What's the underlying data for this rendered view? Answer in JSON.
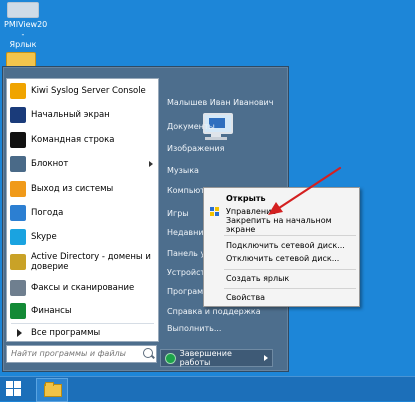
{
  "desktop": {
    "icons": [
      {
        "label_line1": "PMIView20 -",
        "label_line2": "Ярлык"
      }
    ]
  },
  "start_menu": {
    "left_items": [
      {
        "label": "Kiwi Syslog Server Console",
        "icon": "kiwi-icon",
        "color": "#f0a400"
      },
      {
        "label": "Начальный экран",
        "icon": "start-screen-icon",
        "color": "#1a3b7a"
      },
      {
        "label": "Командная строка",
        "icon": "cmd-icon",
        "color": "#111111"
      },
      {
        "label": "Блокнот",
        "icon": "notepad-icon",
        "color": "#4a6a88"
      },
      {
        "label": "Выход из системы",
        "icon": "logoff-key-icon",
        "color": "#f09a1a"
      },
      {
        "label": "Погода",
        "icon": "weather-icon",
        "color": "#2c7fd2"
      },
      {
        "label": "Skype",
        "icon": "skype-icon",
        "color": "#1aa3e0"
      },
      {
        "label_line1": "Active Directory - домены и",
        "label_line2": "доверие",
        "icon": "ad-icon",
        "color": "#c9a227"
      },
      {
        "label": "Факсы и сканирование",
        "icon": "fax-icon",
        "color": "#6f7f8f"
      },
      {
        "label": "Финансы",
        "icon": "finance-icon",
        "color": "#138a36"
      }
    ],
    "all_programs": "Все программы",
    "search_placeholder": "Найти программы и файлы",
    "right_links": [
      "Малышев Иван Иванович",
      "Документы",
      "Изображения",
      "Музыка",
      "Компьютер",
      "Игры",
      "Недавние",
      "Панель у",
      "Устройства",
      "Программы",
      "Справка и поддержка",
      "Выполнить..."
    ],
    "shutdown_label": "Завершение работы"
  },
  "context_menu": {
    "items": [
      {
        "label": "Открыть",
        "bold": true
      },
      {
        "label": "Управление",
        "bold": false,
        "shield": true
      },
      {
        "label": "Закрепить на начальном экране",
        "bold": false
      },
      {
        "label": "Подключить сетевой диск...",
        "bold": false
      },
      {
        "label": "Отключить сетевой диск...",
        "bold": false
      },
      {
        "label": "Создать ярлык",
        "bold": false
      },
      {
        "label": "Свойства",
        "bold": false
      }
    ]
  },
  "colors": {
    "desktop": "#1d86d8",
    "start_menu": "#4d6e8d",
    "arrow": "#d42020"
  }
}
